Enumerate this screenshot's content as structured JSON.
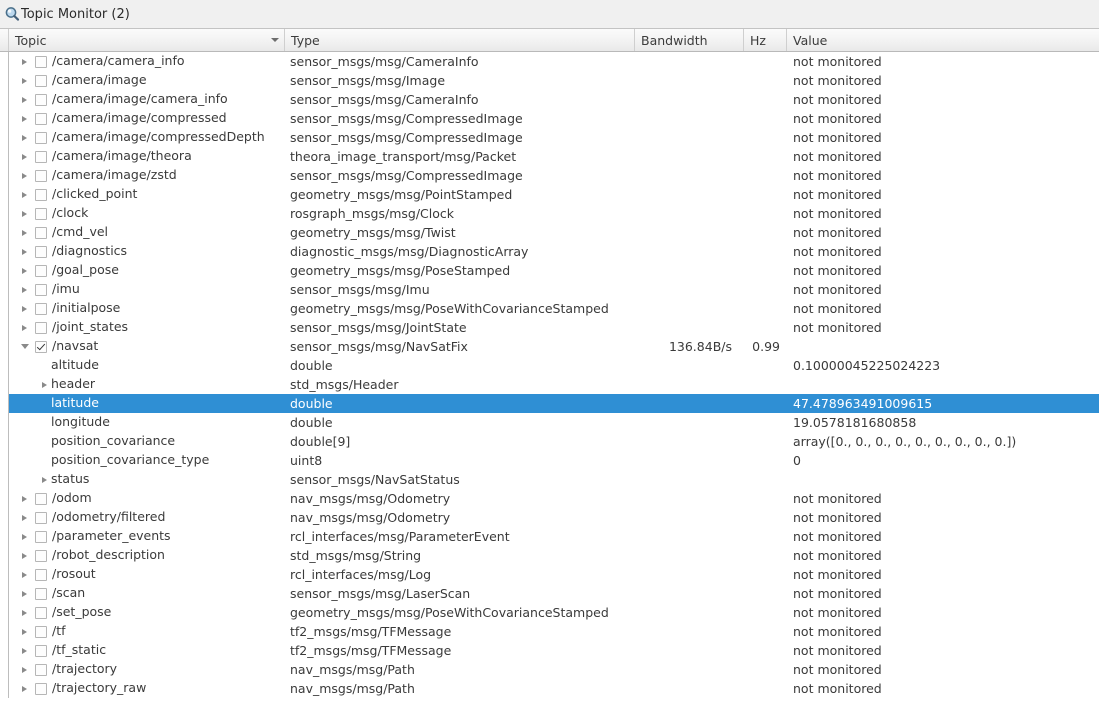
{
  "window": {
    "title": "Topic Monitor (2)",
    "icon": "magnifier-icon"
  },
  "colors": {
    "selection": "#2f8fd4",
    "selection_text": "#ffffff",
    "text": "#3a3a3a",
    "header_border": "#b9b9b9",
    "row_background": "#ffffff"
  },
  "table": {
    "columns": [
      {
        "key": "topic",
        "label": "Topic",
        "sorted": true,
        "sort_direction": "descending"
      },
      {
        "key": "type",
        "label": "Type",
        "sorted": false
      },
      {
        "key": "bandwidth",
        "label": "Bandwidth",
        "sorted": false
      },
      {
        "key": "hz",
        "label": "Hz",
        "sorted": false
      },
      {
        "key": "value",
        "label": "Value",
        "sorted": false
      }
    ],
    "not_monitored_text": "not monitored",
    "rows": [
      {
        "depth": 0,
        "expandable": true,
        "expanded": false,
        "checkbox": true,
        "checked": false,
        "topic": "/camera/camera_info",
        "type": "sensor_msgs/msg/CameraInfo",
        "bandwidth": "",
        "hz": "",
        "value": "not monitored",
        "selected": false
      },
      {
        "depth": 0,
        "expandable": true,
        "expanded": false,
        "checkbox": true,
        "checked": false,
        "topic": "/camera/image",
        "type": "sensor_msgs/msg/Image",
        "bandwidth": "",
        "hz": "",
        "value": "not monitored",
        "selected": false
      },
      {
        "depth": 0,
        "expandable": true,
        "expanded": false,
        "checkbox": true,
        "checked": false,
        "topic": "/camera/image/camera_info",
        "type": "sensor_msgs/msg/CameraInfo",
        "bandwidth": "",
        "hz": "",
        "value": "not monitored",
        "selected": false
      },
      {
        "depth": 0,
        "expandable": true,
        "expanded": false,
        "checkbox": true,
        "checked": false,
        "topic": "/camera/image/compressed",
        "type": "sensor_msgs/msg/CompressedImage",
        "bandwidth": "",
        "hz": "",
        "value": "not monitored",
        "selected": false
      },
      {
        "depth": 0,
        "expandable": true,
        "expanded": false,
        "checkbox": true,
        "checked": false,
        "topic": "/camera/image/compressedDepth",
        "type": "sensor_msgs/msg/CompressedImage",
        "bandwidth": "",
        "hz": "",
        "value": "not monitored",
        "selected": false
      },
      {
        "depth": 0,
        "expandable": true,
        "expanded": false,
        "checkbox": true,
        "checked": false,
        "topic": "/camera/image/theora",
        "type": "theora_image_transport/msg/Packet",
        "bandwidth": "",
        "hz": "",
        "value": "not monitored",
        "selected": false
      },
      {
        "depth": 0,
        "expandable": true,
        "expanded": false,
        "checkbox": true,
        "checked": false,
        "topic": "/camera/image/zstd",
        "type": "sensor_msgs/msg/CompressedImage",
        "bandwidth": "",
        "hz": "",
        "value": "not monitored",
        "selected": false
      },
      {
        "depth": 0,
        "expandable": true,
        "expanded": false,
        "checkbox": true,
        "checked": false,
        "topic": "/clicked_point",
        "type": "geometry_msgs/msg/PointStamped",
        "bandwidth": "",
        "hz": "",
        "value": "not monitored",
        "selected": false
      },
      {
        "depth": 0,
        "expandable": true,
        "expanded": false,
        "checkbox": true,
        "checked": false,
        "topic": "/clock",
        "type": "rosgraph_msgs/msg/Clock",
        "bandwidth": "",
        "hz": "",
        "value": "not monitored",
        "selected": false
      },
      {
        "depth": 0,
        "expandable": true,
        "expanded": false,
        "checkbox": true,
        "checked": false,
        "topic": "/cmd_vel",
        "type": "geometry_msgs/msg/Twist",
        "bandwidth": "",
        "hz": "",
        "value": "not monitored",
        "selected": false
      },
      {
        "depth": 0,
        "expandable": true,
        "expanded": false,
        "checkbox": true,
        "checked": false,
        "topic": "/diagnostics",
        "type": "diagnostic_msgs/msg/DiagnosticArray",
        "bandwidth": "",
        "hz": "",
        "value": "not monitored",
        "selected": false
      },
      {
        "depth": 0,
        "expandable": true,
        "expanded": false,
        "checkbox": true,
        "checked": false,
        "topic": "/goal_pose",
        "type": "geometry_msgs/msg/PoseStamped",
        "bandwidth": "",
        "hz": "",
        "value": "not monitored",
        "selected": false
      },
      {
        "depth": 0,
        "expandable": true,
        "expanded": false,
        "checkbox": true,
        "checked": false,
        "topic": "/imu",
        "type": "sensor_msgs/msg/Imu",
        "bandwidth": "",
        "hz": "",
        "value": "not monitored",
        "selected": false
      },
      {
        "depth": 0,
        "expandable": true,
        "expanded": false,
        "checkbox": true,
        "checked": false,
        "topic": "/initialpose",
        "type": "geometry_msgs/msg/PoseWithCovarianceStamped",
        "bandwidth": "",
        "hz": "",
        "value": "not monitored",
        "selected": false
      },
      {
        "depth": 0,
        "expandable": true,
        "expanded": false,
        "checkbox": true,
        "checked": false,
        "topic": "/joint_states",
        "type": "sensor_msgs/msg/JointState",
        "bandwidth": "",
        "hz": "",
        "value": "not monitored",
        "selected": false
      },
      {
        "depth": 0,
        "expandable": true,
        "expanded": true,
        "checkbox": true,
        "checked": true,
        "topic": "/navsat",
        "type": "sensor_msgs/msg/NavSatFix",
        "bandwidth": "136.84B/s",
        "hz": "0.99",
        "value": "",
        "selected": false
      },
      {
        "depth": 1,
        "expandable": false,
        "expanded": false,
        "checkbox": false,
        "checked": false,
        "topic": "altitude",
        "type": "double",
        "bandwidth": "",
        "hz": "",
        "value": "0.10000045225024223",
        "selected": false
      },
      {
        "depth": 1,
        "expandable": true,
        "expanded": false,
        "checkbox": false,
        "checked": false,
        "topic": "header",
        "type": "std_msgs/Header",
        "bandwidth": "",
        "hz": "",
        "value": "",
        "selected": false
      },
      {
        "depth": 1,
        "expandable": false,
        "expanded": false,
        "checkbox": false,
        "checked": false,
        "topic": "latitude",
        "type": "double",
        "bandwidth": "",
        "hz": "",
        "value": "47.478963491009615",
        "selected": true
      },
      {
        "depth": 1,
        "expandable": false,
        "expanded": false,
        "checkbox": false,
        "checked": false,
        "topic": "longitude",
        "type": "double",
        "bandwidth": "",
        "hz": "",
        "value": "19.0578181680858",
        "selected": false
      },
      {
        "depth": 1,
        "expandable": false,
        "expanded": false,
        "checkbox": false,
        "checked": false,
        "topic": "position_covariance",
        "type": "double[9]",
        "bandwidth": "",
        "hz": "",
        "value": "array([0., 0., 0., 0., 0., 0., 0., 0., 0.])",
        "selected": false
      },
      {
        "depth": 1,
        "expandable": false,
        "expanded": false,
        "checkbox": false,
        "checked": false,
        "topic": "position_covariance_type",
        "type": "uint8",
        "bandwidth": "",
        "hz": "",
        "value": "0",
        "selected": false
      },
      {
        "depth": 1,
        "expandable": true,
        "expanded": false,
        "checkbox": false,
        "checked": false,
        "topic": "status",
        "type": "sensor_msgs/NavSatStatus",
        "bandwidth": "",
        "hz": "",
        "value": "",
        "selected": false
      },
      {
        "depth": 0,
        "expandable": true,
        "expanded": false,
        "checkbox": true,
        "checked": false,
        "topic": "/odom",
        "type": "nav_msgs/msg/Odometry",
        "bandwidth": "",
        "hz": "",
        "value": "not monitored",
        "selected": false
      },
      {
        "depth": 0,
        "expandable": true,
        "expanded": false,
        "checkbox": true,
        "checked": false,
        "topic": "/odometry/filtered",
        "type": "nav_msgs/msg/Odometry",
        "bandwidth": "",
        "hz": "",
        "value": "not monitored",
        "selected": false
      },
      {
        "depth": 0,
        "expandable": true,
        "expanded": false,
        "checkbox": true,
        "checked": false,
        "topic": "/parameter_events",
        "type": "rcl_interfaces/msg/ParameterEvent",
        "bandwidth": "",
        "hz": "",
        "value": "not monitored",
        "selected": false
      },
      {
        "depth": 0,
        "expandable": true,
        "expanded": false,
        "checkbox": true,
        "checked": false,
        "topic": "/robot_description",
        "type": "std_msgs/msg/String",
        "bandwidth": "",
        "hz": "",
        "value": "not monitored",
        "selected": false
      },
      {
        "depth": 0,
        "expandable": true,
        "expanded": false,
        "checkbox": true,
        "checked": false,
        "topic": "/rosout",
        "type": "rcl_interfaces/msg/Log",
        "bandwidth": "",
        "hz": "",
        "value": "not monitored",
        "selected": false
      },
      {
        "depth": 0,
        "expandable": true,
        "expanded": false,
        "checkbox": true,
        "checked": false,
        "topic": "/scan",
        "type": "sensor_msgs/msg/LaserScan",
        "bandwidth": "",
        "hz": "",
        "value": "not monitored",
        "selected": false
      },
      {
        "depth": 0,
        "expandable": true,
        "expanded": false,
        "checkbox": true,
        "checked": false,
        "topic": "/set_pose",
        "type": "geometry_msgs/msg/PoseWithCovarianceStamped",
        "bandwidth": "",
        "hz": "",
        "value": "not monitored",
        "selected": false
      },
      {
        "depth": 0,
        "expandable": true,
        "expanded": false,
        "checkbox": true,
        "checked": false,
        "topic": "/tf",
        "type": "tf2_msgs/msg/TFMessage",
        "bandwidth": "",
        "hz": "",
        "value": "not monitored",
        "selected": false
      },
      {
        "depth": 0,
        "expandable": true,
        "expanded": false,
        "checkbox": true,
        "checked": false,
        "topic": "/tf_static",
        "type": "tf2_msgs/msg/TFMessage",
        "bandwidth": "",
        "hz": "",
        "value": "not monitored",
        "selected": false
      },
      {
        "depth": 0,
        "expandable": true,
        "expanded": false,
        "checkbox": true,
        "checked": false,
        "topic": "/trajectory",
        "type": "nav_msgs/msg/Path",
        "bandwidth": "",
        "hz": "",
        "value": "not monitored",
        "selected": false
      },
      {
        "depth": 0,
        "expandable": true,
        "expanded": false,
        "checkbox": true,
        "checked": false,
        "topic": "/trajectory_raw",
        "type": "nav_msgs/msg/Path",
        "bandwidth": "",
        "hz": "",
        "value": "not monitored",
        "selected": false
      }
    ]
  }
}
